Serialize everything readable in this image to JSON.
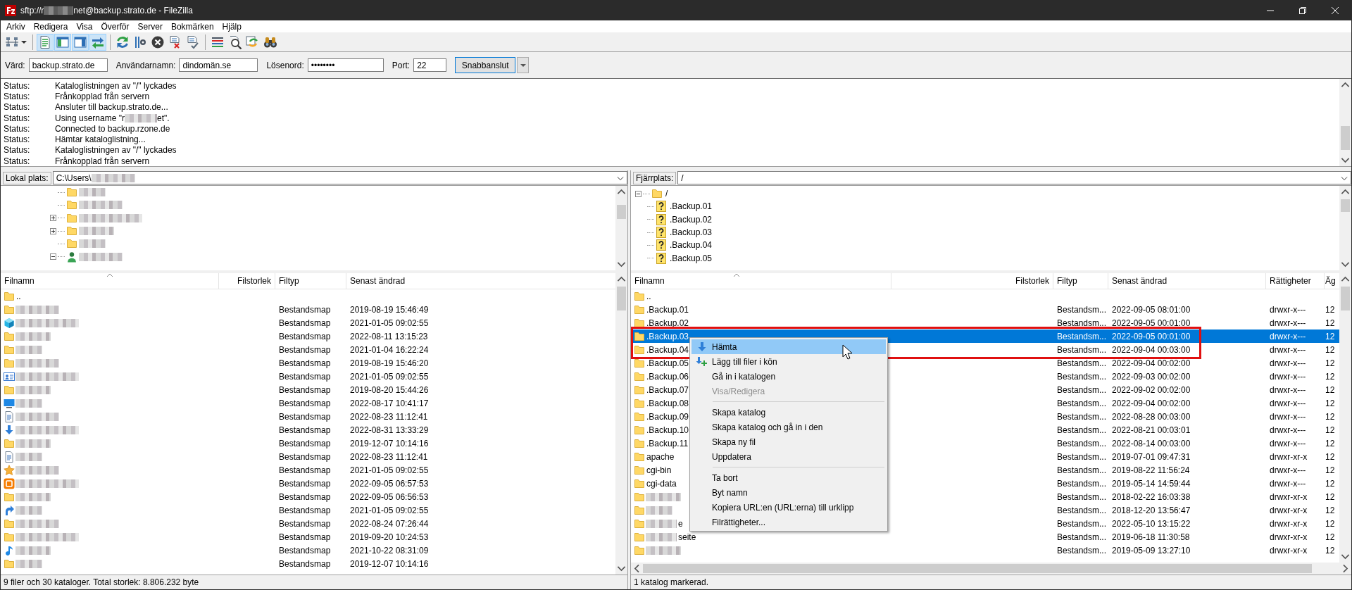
{
  "window": {
    "title_start": "sftp://r",
    "title_end": "net@backup.strato.de - FileZilla"
  },
  "menu": [
    "Arkiv",
    "Redigera",
    "Visa",
    "Överför",
    "Server",
    "Bokmärken",
    "Hjälp"
  ],
  "toolbar": [
    {
      "kind": "site-manager",
      "pressed": false
    },
    {
      "kind": "separator"
    },
    {
      "kind": "log",
      "pressed": true
    },
    {
      "kind": "local-tree",
      "pressed": true
    },
    {
      "kind": "remote-tree",
      "pressed": true
    },
    {
      "kind": "queue",
      "pressed": true
    },
    {
      "kind": "separator"
    },
    {
      "kind": "refresh",
      "pressed": false
    },
    {
      "kind": "process-queue",
      "pressed": false
    },
    {
      "kind": "cancel",
      "pressed": false
    },
    {
      "kind": "disconnect",
      "pressed": false
    },
    {
      "kind": "reconnect",
      "pressed": false
    },
    {
      "kind": "separator"
    },
    {
      "kind": "filter",
      "pressed": false
    },
    {
      "kind": "compare",
      "pressed": false
    },
    {
      "kind": "sync",
      "pressed": false
    },
    {
      "kind": "search",
      "pressed": false
    }
  ],
  "quickconnect": {
    "fields": [
      {
        "label": "Värd:",
        "value": "backup.strato.de",
        "kind": "host"
      },
      {
        "label": "Användarnamn:",
        "value": "dindomän.se",
        "kind": "user"
      },
      {
        "label": "Lösenord:",
        "value": "••••••••",
        "kind": "password"
      },
      {
        "label": "Port:",
        "value": "22",
        "kind": "port"
      }
    ],
    "button": "Snabbanslut"
  },
  "log": [
    {
      "label": "Status:",
      "message": "Kataloglistningen av \"/\" lyckades"
    },
    {
      "label": "Status:",
      "message": "Frånkopplad från servern"
    },
    {
      "label": "Status:",
      "message": "Ansluter till backup.strato.de..."
    },
    {
      "label": "Status:",
      "message": "Using username \"r",
      "message_end": "et\"."
    },
    {
      "label": "Status:",
      "message": "Connected to backup.rzone.de"
    },
    {
      "label": "Status:",
      "message": "Hämtar kataloglistning..."
    },
    {
      "label": "Status:",
      "message": "Kataloglistningen av \"/\" lyckades"
    },
    {
      "label": "Status:",
      "message": "Frånkopplad från servern"
    }
  ],
  "local": {
    "label": "Lokal plats:",
    "path": "C:\\Users\\",
    "tree": [
      {
        "kind": "folder"
      },
      {
        "kind": "folder"
      },
      {
        "kind": "folder",
        "expanded": false
      },
      {
        "kind": "folder",
        "expanded": false
      },
      {
        "kind": "folder"
      },
      {
        "kind": "user",
        "expanded": true
      }
    ],
    "columns": [
      "Filnamn",
      "Filstorlek",
      "Filtyp",
      "Senast ändrad"
    ],
    "rows": [
      {
        "kind": "folder",
        "name": ".."
      },
      {
        "kind": "folder",
        "type": "Bestandsmap",
        "modified": "2019-08-19 15:46:49"
      },
      {
        "kind": "cube",
        "type": "Bestandsmap",
        "modified": "2021-01-05 09:02:55"
      },
      {
        "kind": "folder",
        "type": "Bestandsmap",
        "modified": "2022-08-11 13:15:23"
      },
      {
        "kind": "folder",
        "type": "Bestandsmap",
        "modified": "2021-01-04 16:22:24"
      },
      {
        "kind": "folder",
        "type": "Bestandsmap",
        "modified": "2019-08-19 15:46:20"
      },
      {
        "kind": "contact",
        "type": "Bestandsmap",
        "modified": "2021-01-05 09:02:55"
      },
      {
        "kind": "folder",
        "type": "Bestandsmap",
        "modified": "2019-08-20 15:44:26"
      },
      {
        "kind": "monitor",
        "type": "Bestandsmap",
        "modified": "2022-08-17 10:41:17"
      },
      {
        "kind": "doc",
        "type": "Bestandsmap",
        "modified": "2022-08-23 11:12:41"
      },
      {
        "kind": "download",
        "type": "Bestandsmap",
        "modified": "2022-08-31 13:33:29"
      },
      {
        "kind": "folder",
        "type": "Bestandsmap",
        "modified": "2019-12-07 10:14:16"
      },
      {
        "kind": "doc",
        "type": "Bestandsmap",
        "modified": "2022-08-23 11:12:41"
      },
      {
        "kind": "star",
        "type": "Bestandsmap",
        "modified": "2021-01-05 09:02:55"
      },
      {
        "kind": "app",
        "type": "Bestandsmap",
        "modified": "2022-09-05 06:57:53"
      },
      {
        "kind": "folder",
        "type": "Bestandsmap",
        "modified": "2022-09-05 06:56:53"
      },
      {
        "kind": "shortcut",
        "type": "Bestandsmap",
        "modified": "2021-01-05 09:02:55"
      },
      {
        "kind": "folder",
        "type": "Bestandsmap",
        "modified": "2022-08-24 07:26:44"
      },
      {
        "kind": "folder",
        "type": "Bestandsmap",
        "modified": "2019-09-20 10:24:53"
      },
      {
        "kind": "music",
        "type": "Bestandsmap",
        "modified": "2021-10-22 08:31:09"
      },
      {
        "kind": "folder",
        "type": "Bestandsmap",
        "modified": "2019-12-07 10:14:16"
      }
    ],
    "status": "9 filer och 30 kataloger. Total storlek: 8.806.232 byte"
  },
  "remote": {
    "label": "Fjärrplats:",
    "path": "/",
    "tree": {
      "name": "/",
      "kind": "folder",
      "expanded": true,
      "children": [
        {
          "name": ".Backup.01",
          "kind": "unknown"
        },
        {
          "name": ".Backup.02",
          "kind": "unknown"
        },
        {
          "name": ".Backup.03",
          "kind": "unknown"
        },
        {
          "name": ".Backup.04",
          "kind": "unknown"
        },
        {
          "name": ".Backup.05",
          "kind": "unknown"
        }
      ]
    },
    "columns": [
      "Filnamn",
      "Filstorlek",
      "Filtyp",
      "Senast ändrad",
      "Rättigheter",
      "Äg"
    ],
    "rows": [
      {
        "kind": "folder",
        "name": "..",
        "selected": false
      },
      {
        "kind": "folder",
        "name": ".Backup.01",
        "type": "Bestandsm...",
        "modified": "2022-09-05 08:01:00",
        "permissions": "drwxr-x---",
        "owner": "12",
        "selected": false
      },
      {
        "kind": "folder",
        "name": ".Backup.02",
        "type": "Bestandsm...",
        "modified": "2022-09-05 00:01:00",
        "permissions": "drwxr-x---",
        "owner": "12",
        "selected": false
      },
      {
        "kind": "folder",
        "name": ".Backup.03",
        "type": "Bestandsm...",
        "modified": "2022-09-05 00:01:00",
        "permissions": "drwxr-x---",
        "owner": "12",
        "selected": true
      },
      {
        "kind": "folder",
        "name": ".Backup.04",
        "type": "Bestandsm...",
        "modified": "2022-09-04 00:03:00",
        "permissions": "drwxr-x---",
        "owner": "12",
        "selected": false
      },
      {
        "kind": "folder",
        "name": ".Backup.05",
        "type": "Bestandsm...",
        "modified": "2022-09-04 00:02:00",
        "permissions": "drwxr-x---",
        "owner": "12",
        "selected": false
      },
      {
        "kind": "folder",
        "name": ".Backup.06",
        "type": "Bestandsm...",
        "modified": "2022-09-03 00:02:00",
        "permissions": "drwxr-x---",
        "owner": "12",
        "selected": false
      },
      {
        "kind": "folder",
        "name": ".Backup.07",
        "type": "Bestandsm...",
        "modified": "2022-09-02 00:02:00",
        "permissions": "drwxr-x---",
        "owner": "12",
        "selected": false
      },
      {
        "kind": "folder",
        "name": ".Backup.08",
        "type": "Bestandsm...",
        "modified": "2022-09-04 00:02:00",
        "permissions": "drwxr-x---",
        "owner": "12",
        "selected": false
      },
      {
        "kind": "folder",
        "name": ".Backup.09",
        "type": "Bestandsm...",
        "modified": "2022-08-28 00:03:00",
        "permissions": "drwxr-x---",
        "owner": "12",
        "selected": false
      },
      {
        "kind": "folder",
        "name": ".Backup.10",
        "type": "Bestandsm...",
        "modified": "2022-08-21 00:03:01",
        "permissions": "drwxr-x---",
        "owner": "12",
        "selected": false
      },
      {
        "kind": "folder",
        "name": ".Backup.11",
        "type": "Bestandsm...",
        "modified": "2022-08-14 00:03:00",
        "permissions": "drwxr-x---",
        "owner": "12",
        "selected": false
      },
      {
        "kind": "folder",
        "name": "apache",
        "type": "Bestandsm...",
        "modified": "2019-07-01 09:47:31",
        "permissions": "drwxr-xr-x",
        "owner": "12",
        "selected": false
      },
      {
        "kind": "folder",
        "name": "cgi-bin",
        "type": "Bestandsm...",
        "modified": "2019-08-22 11:56:24",
        "permissions": "drwxr-x---",
        "owner": "12",
        "selected": false
      },
      {
        "kind": "folder",
        "name": "cgi-data",
        "type": "Bestandsm...",
        "modified": "2019-05-14 14:59:44",
        "permissions": "drwxr-x---",
        "owner": "12",
        "selected": false
      },
      {
        "kind": "folder",
        "type": "Bestandsm...",
        "modified": "2018-02-22 16:03:38",
        "permissions": "drwxr-xr-x",
        "owner": "12",
        "selected": false
      },
      {
        "kind": "folder",
        "type": "Bestandsm...",
        "modified": "2018-12-20 13:56:47",
        "permissions": "drwxr-xr-x",
        "owner": "12",
        "selected": false
      },
      {
        "kind": "folder",
        "name_end": "e",
        "type": "Bestandsm...",
        "modified": "2022-05-10 13:15:22",
        "permissions": "drwxr-xr-x",
        "owner": "12",
        "selected": false
      },
      {
        "kind": "folder",
        "name_end": "seite",
        "type": "Bestandsm...",
        "modified": "2019-06-18 11:30:58",
        "permissions": "drwxr-xr-x",
        "owner": "12",
        "selected": false
      },
      {
        "kind": "folder",
        "type": "Bestandsm...",
        "modified": "2019-05-09 13:27:10",
        "permissions": "drwxr-xr-x",
        "owner": "12",
        "selected": false
      }
    ],
    "status": "1 katalog markerad."
  },
  "context_menu": [
    {
      "kind": "download",
      "label": "Hämta",
      "selected": true,
      "disabled": false
    },
    {
      "kind": "add",
      "label": "Lägg till filer i kön",
      "selected": false,
      "disabled": false
    },
    {
      "kind": "item",
      "label": "Gå in i katalogen",
      "selected": false,
      "disabled": false
    },
    {
      "kind": "item",
      "label": "Visa/Redigera",
      "selected": false,
      "disabled": true
    },
    {
      "kind": "separator"
    },
    {
      "kind": "item",
      "label": "Skapa katalog",
      "selected": false,
      "disabled": false
    },
    {
      "kind": "item",
      "label": "Skapa katalog och gå in i den",
      "selected": false,
      "disabled": false
    },
    {
      "kind": "item",
      "label": "Skapa ny fil",
      "selected": false,
      "disabled": false
    },
    {
      "kind": "item",
      "label": "Uppdatera",
      "selected": false,
      "disabled": false
    },
    {
      "kind": "separator"
    },
    {
      "kind": "item",
      "label": "Ta bort",
      "selected": false,
      "disabled": false
    },
    {
      "kind": "item",
      "label": "Byt namn",
      "selected": false,
      "disabled": false
    },
    {
      "kind": "item",
      "label": "Kopiera URL:en (URL:erna) till urklipp",
      "selected": false,
      "disabled": false
    },
    {
      "kind": "item",
      "label": "Filrättigheter...",
      "selected": false,
      "disabled": false
    }
  ]
}
